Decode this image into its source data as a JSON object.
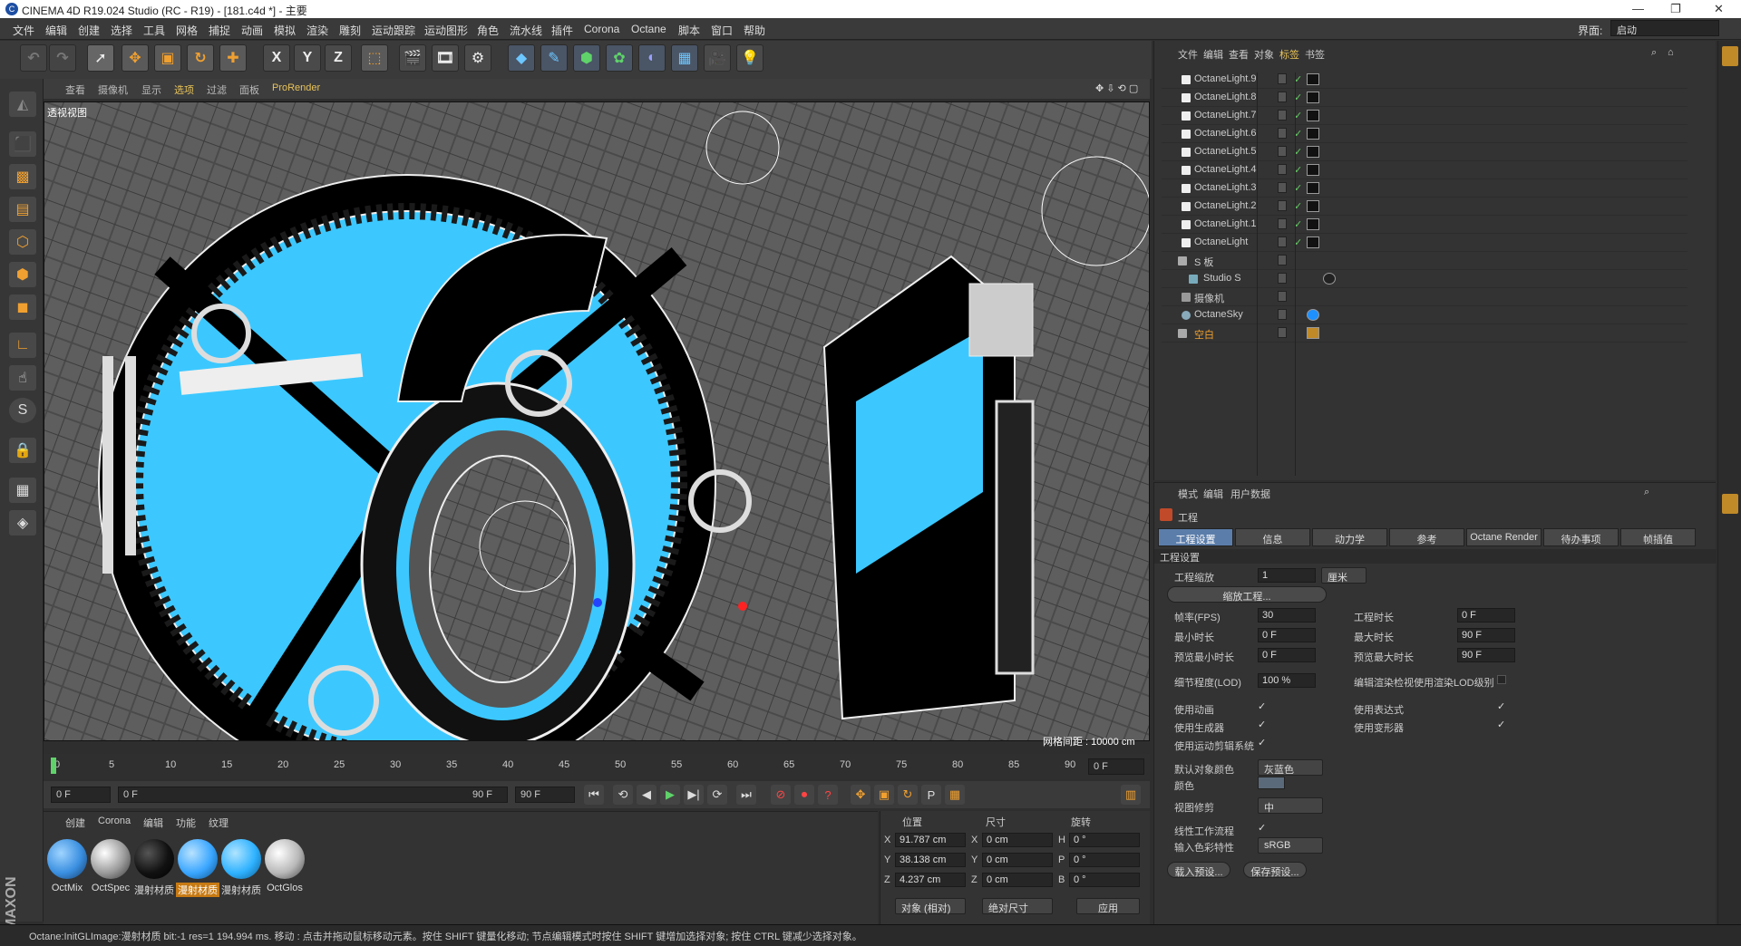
{
  "window": {
    "title": "CINEMA 4D R19.024 Studio (RC - R19) - [181.c4d *] - 主要",
    "layout_label": "界面:",
    "layout_value": "启动"
  },
  "menu": [
    "文件",
    "编辑",
    "创建",
    "选择",
    "工具",
    "网格",
    "捕捉",
    "动画",
    "模拟",
    "渲染",
    "雕刻",
    "运动跟踪",
    "运动图形",
    "角色",
    "流水线",
    "插件",
    "Corona",
    "Octane",
    "脚本",
    "窗口",
    "帮助"
  ],
  "toolbar": {
    "x": "X",
    "y": "Y",
    "z": "Z"
  },
  "viewport": {
    "menu": [
      "查看",
      "摄像机",
      "显示",
      "选项",
      "过滤",
      "面板",
      "ProRender"
    ],
    "label": "透视视图",
    "grid_info": "网格间距 : 10000 cm",
    "accent_color": "#3cc8ff"
  },
  "timeline": {
    "ticks": [
      "0",
      "5",
      "10",
      "15",
      "20",
      "25",
      "30",
      "35",
      "40",
      "45",
      "50",
      "55",
      "60",
      "65",
      "70",
      "75",
      "80",
      "85",
      "90"
    ],
    "current": "0 F",
    "start": "0 F",
    "range_start": "0 F",
    "range_end": "90 F",
    "end": "90 F"
  },
  "materials": {
    "menu": [
      "创建",
      "Corona",
      "编辑",
      "功能",
      "纹理"
    ],
    "items": [
      {
        "name": "OctMix",
        "color": "#3a8fe0"
      },
      {
        "name": "OctSpec",
        "color": "#9a9a9a"
      },
      {
        "name": "漫射材质",
        "color": "#111111"
      },
      {
        "name": "漫射材质",
        "color": "#3aa6ff",
        "selected": true
      },
      {
        "name": "漫射材质",
        "color": "#2fb2ff"
      },
      {
        "name": "OctGlos",
        "color": "#b8b8b8"
      }
    ]
  },
  "coordinates": {
    "headers": [
      "位置",
      "尺寸",
      "旋转"
    ],
    "rows": [
      {
        "axis": "X",
        "pos": "91.787 cm",
        "size_axis": "X",
        "size": "0 cm",
        "rot_axis": "H",
        "rot": "0 °"
      },
      {
        "axis": "Y",
        "pos": "38.138 cm",
        "size_axis": "Y",
        "size": "0 cm",
        "rot_axis": "P",
        "rot": "0 °"
      },
      {
        "axis": "Z",
        "pos": "4.237 cm",
        "size_axis": "Z",
        "size": "0 cm",
        "rot_axis": "B",
        "rot": "0 °"
      }
    ],
    "mode1": "对象 (相对)",
    "mode2": "绝对尺寸",
    "apply": "应用"
  },
  "status": "Octane:InitGLImage:漫射材质  bit:-1 res=1  194.994 ms.  移动 : 点击并拖动鼠标移动元素。按住 SHIFT 键量化移动; 节点编辑模式时按住 SHIFT 键增加选择对象; 按住 CTRL 键减少选择对象。",
  "object_manager": {
    "menu": [
      "文件",
      "编辑",
      "查看",
      "对象",
      "标签",
      "书签"
    ],
    "objects": [
      "OctaneLight.9",
      "OctaneLight.8",
      "OctaneLight.7",
      "OctaneLight.6",
      "OctaneLight.5",
      "OctaneLight.4",
      "OctaneLight.3",
      "OctaneLight.2",
      "OctaneLight.1",
      "OctaneLight",
      "S 板",
      "Studio S",
      "摄像机",
      "OctaneSky",
      "空白"
    ]
  },
  "attributes": {
    "menu": [
      "模式",
      "编辑",
      "用户数据"
    ],
    "title": "工程",
    "tabs": [
      "工程设置",
      "信息",
      "动力学",
      "参考",
      "Octane Render",
      "待办事项",
      "帧插值"
    ],
    "section": "工程设置",
    "scale_label": "工程缩放",
    "scale_value": "1",
    "scale_unit": "厘米",
    "scale_button": "缩放工程...",
    "fps_label": "帧率(FPS)",
    "fps_value": "30",
    "duration_label": "工程时长",
    "duration_value": "0 F",
    "min_label": "最小时长",
    "min_value": "0 F",
    "max_label": "最大时长",
    "max_value": "90 F",
    "pmin_label": "预览最小时长",
    "pmin_value": "0 F",
    "pmax_label": "预览最大时长",
    "pmax_value": "90 F",
    "lod_label": "细节程度(LOD)",
    "lod_value": "100 %",
    "lod_check_label": "编辑渲染检视使用渲染LOD级别",
    "anim_label": "使用动画",
    "expr_label": "使用表达式",
    "gen_label": "使用生成器",
    "deform_label": "使用变形器",
    "motion_label": "使用运动剪辑系统",
    "objcolor_label": "默认对象颜色",
    "objcolor_value": "灰蓝色",
    "color_label": "颜色",
    "clip_label": "视图修剪",
    "clip_value": "中",
    "linear_label": "线性工作流程",
    "input_label": "输入色彩特性",
    "input_value": "sRGB",
    "load_button": "载入预设...",
    "save_button": "保存预设..."
  }
}
